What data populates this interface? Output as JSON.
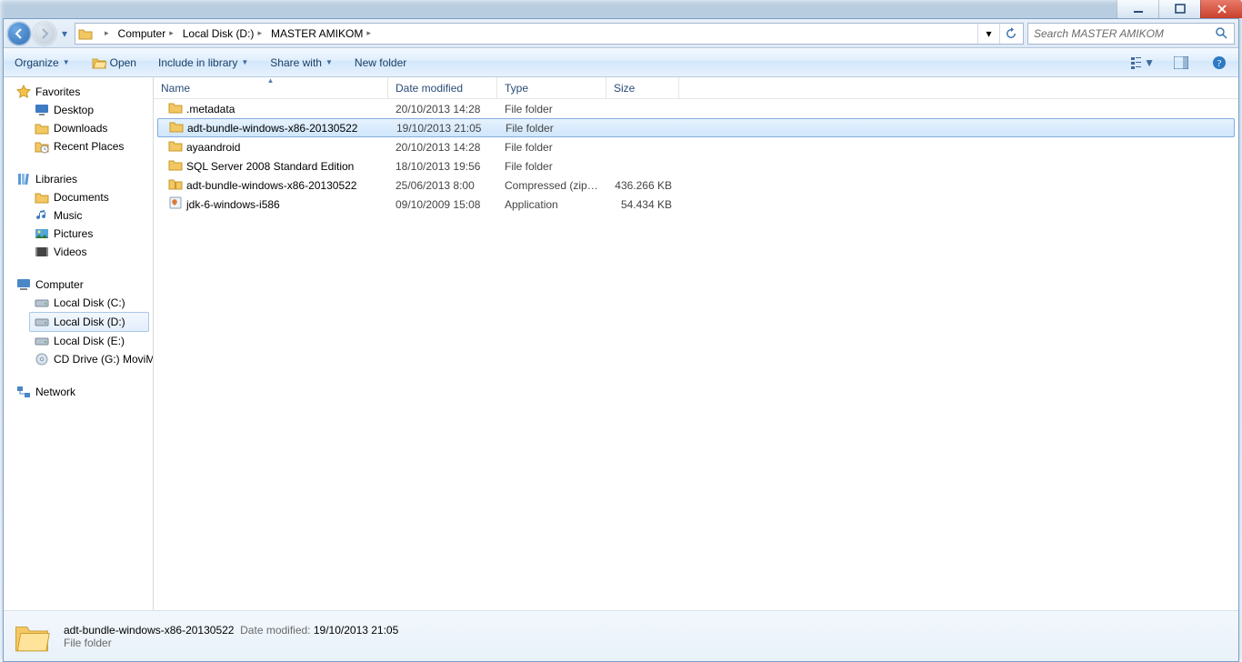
{
  "window": {
    "minimize": "_",
    "maximize": "❐",
    "close": "✕"
  },
  "breadcrumb": [
    "Computer",
    "Local Disk (D:)",
    "MASTER AMIKOM"
  ],
  "search_placeholder": "Search MASTER AMIKOM",
  "toolbar": {
    "organize": "Organize",
    "open": "Open",
    "include": "Include in library",
    "share": "Share with",
    "newfolder": "New folder"
  },
  "nav": {
    "favorites": {
      "label": "Favorites",
      "items": [
        "Desktop",
        "Downloads",
        "Recent Places"
      ]
    },
    "libraries": {
      "label": "Libraries",
      "items": [
        "Documents",
        "Music",
        "Pictures",
        "Videos"
      ]
    },
    "computer": {
      "label": "Computer",
      "items": [
        "Local Disk (C:)",
        "Local Disk (D:)",
        "Local Disk (E:)",
        "CD Drive (G:) MoviM"
      ],
      "selected": 1
    },
    "network": {
      "label": "Network"
    }
  },
  "columns": {
    "name": "Name",
    "date": "Date modified",
    "type": "Type",
    "size": "Size"
  },
  "files": [
    {
      "icon": "folder",
      "name": ".metadata",
      "date": "20/10/2013 14:28",
      "type": "File folder",
      "size": "",
      "sel": false
    },
    {
      "icon": "folder",
      "name": "adt-bundle-windows-x86-20130522",
      "date": "19/10/2013 21:05",
      "type": "File folder",
      "size": "",
      "sel": true
    },
    {
      "icon": "folder",
      "name": "ayaandroid",
      "date": "20/10/2013 14:28",
      "type": "File folder",
      "size": "",
      "sel": false
    },
    {
      "icon": "folder",
      "name": "SQL Server 2008 Standard Edition",
      "date": "18/10/2013 19:56",
      "type": "File folder",
      "size": "",
      "sel": false
    },
    {
      "icon": "zip",
      "name": "adt-bundle-windows-x86-20130522",
      "date": "25/06/2013 8:00",
      "type": "Compressed (zipp...",
      "size": "436.266 KB",
      "sel": false
    },
    {
      "icon": "app",
      "name": "jdk-6-windows-i586",
      "date": "09/10/2009 15:08",
      "type": "Application",
      "size": "54.434 KB",
      "sel": false
    }
  ],
  "details": {
    "title": "adt-bundle-windows-x86-20130522",
    "meta_label": "Date modified:",
    "meta_value": "19/10/2013 21:05",
    "subtitle": "File folder"
  }
}
